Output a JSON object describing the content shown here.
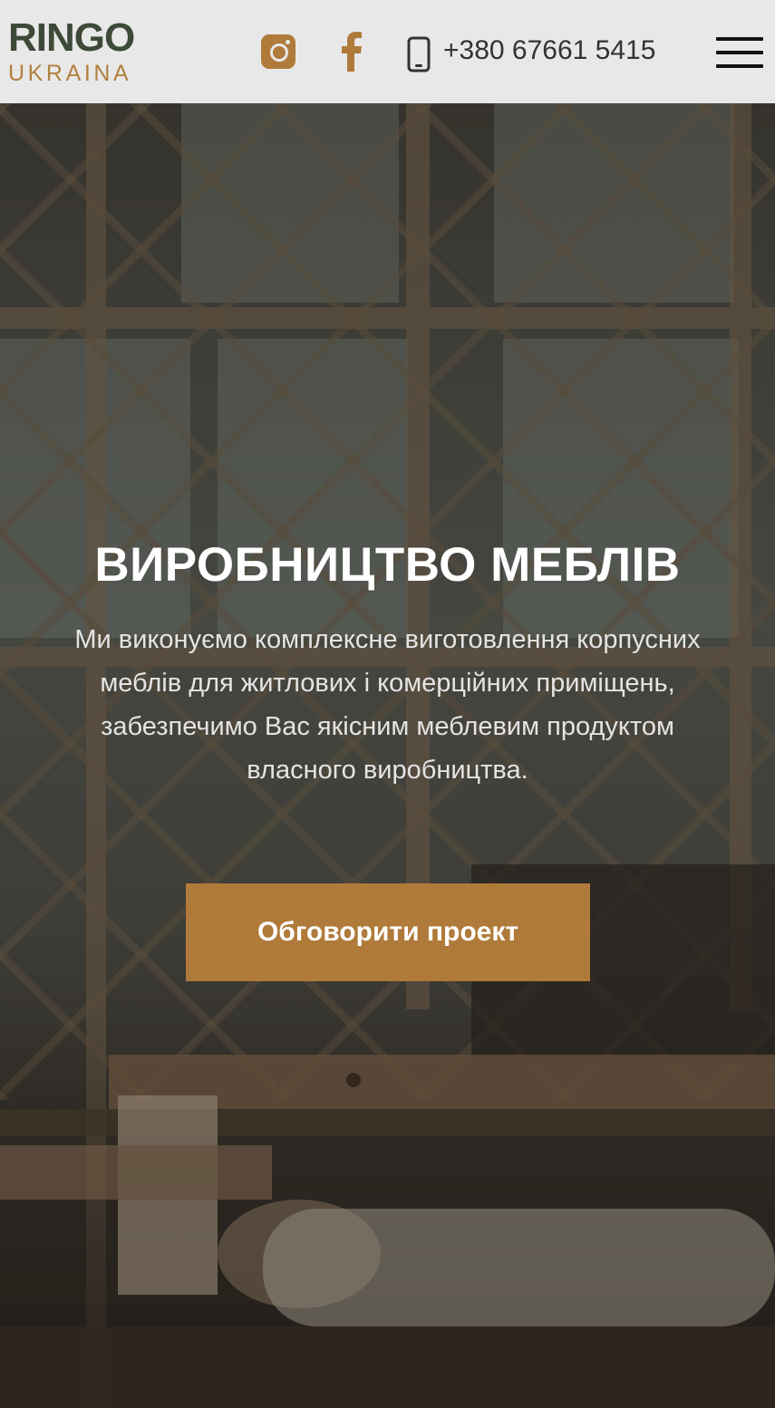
{
  "colors": {
    "accent": "#b07a3b",
    "header_bg": "#e8e8e8",
    "logo_green": "#3e4a39",
    "text_dark": "#333333"
  },
  "header": {
    "logo": {
      "top": "RINGO",
      "bottom": "UKRAINA"
    },
    "social": [
      {
        "icon": "instagram-icon"
      },
      {
        "icon": "facebook-icon"
      }
    ],
    "phone": {
      "icon": "mobile-phone-icon",
      "number": "+380 67661 5415"
    },
    "menu_icon": "hamburger-menu-icon"
  },
  "hero": {
    "title": "ВИРОБНИЦТВО МЕБЛІВ",
    "text_lines": [
      "Ми виконуємо комплексне виготовлення корпусних",
      "меблів для житлових і комерційних приміщень,",
      "забезпечимо Вас якісним меблевим продуктом",
      "власного виробництва."
    ],
    "cta_label": "Обговорити проект"
  }
}
